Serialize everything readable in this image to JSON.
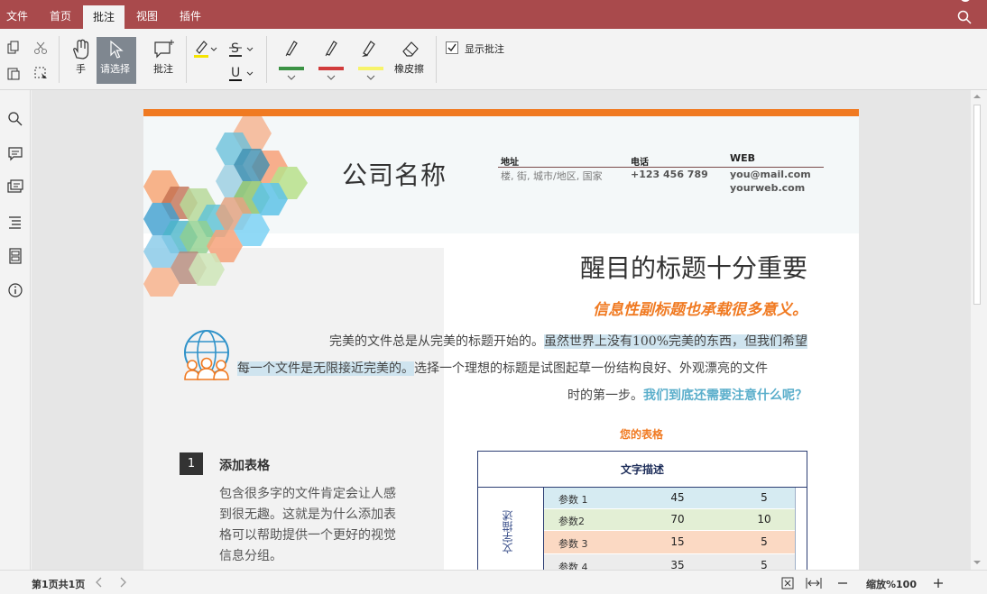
{
  "menu": {
    "items": [
      "文件",
      "首页",
      "批注",
      "视图",
      "插件"
    ],
    "active_index": 2
  },
  "ribbon": {
    "hand_label": "手",
    "select_label": "请选择",
    "comment_label": "批注",
    "eraser_label": "橡皮擦",
    "show_comments_label": "显示批注",
    "show_comments_checked": true,
    "pen_colors": [
      "#3b9244",
      "#d13b3b",
      "#f7f36a"
    ],
    "highlight_color": "#f5e400"
  },
  "document": {
    "company": "公司名称",
    "address_header": "地址",
    "address_value": "楼, 街, 城市/地区, 国家",
    "phone_header": "电话",
    "phone_value": "+123 456 789",
    "web_header": "WEB",
    "email_value": "you@mail.com",
    "web_value": "yourweb.com",
    "headline": "醒目的标题十分重要",
    "subheadline": "信息性副标题也承载很多意义。",
    "para_line1_a": "完美的文件总是从完美的标题开始的。",
    "para_line1_b": "虽然世界上没有100%完美的东西，但我们希望",
    "para_line2_a": "每一个文件是无限接近完美的。",
    "para_line2_b": "选择一个理想的标题是试图起草一份结构良好、外观漂亮的文件",
    "para_line3_a": "时的第一步。",
    "para_line3_b": "我们到底还需要注意什么呢？",
    "step_number": "1",
    "step_title": "添加表格",
    "step_lines": [
      "包含很多字的文件肯定会让人感",
      "到很无趣。这就是为什么添加表",
      "格可以帮助提供一个更好的视觉",
      "信息分组。"
    ],
    "table_caption": "您的表格",
    "table_header": "文字描述",
    "table_side_label": "文字描述",
    "table_rows": [
      {
        "label": "参数 1",
        "a": "45",
        "b": "5",
        "color": "#d6ebf2"
      },
      {
        "label": "参数2",
        "a": "70",
        "b": "10",
        "color": "#e3efd5"
      },
      {
        "label": "参数 3",
        "a": "15",
        "b": "5",
        "color": "#fbd9c3"
      },
      {
        "label": "参数 4",
        "a": "35",
        "b": "5",
        "color": "#ececec"
      }
    ]
  },
  "status": {
    "page_info": "第1页共1页",
    "zoom_label": "缩放%100"
  },
  "colors": {
    "menubar": "#a94a4c",
    "accent_orange": "#f07a22",
    "accent_teal": "#5aaecb"
  }
}
